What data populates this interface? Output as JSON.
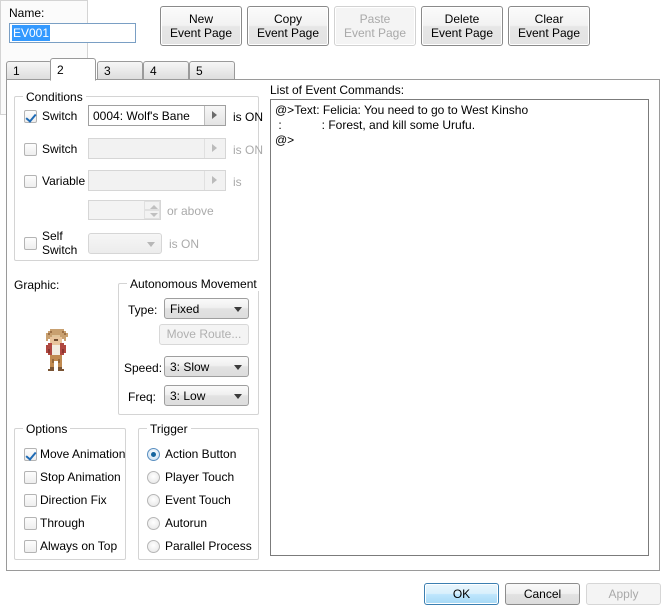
{
  "window": {
    "name_label": "Name:",
    "name_value": "EV001"
  },
  "page_buttons": [
    {
      "line1": "New",
      "line2": "Event Page",
      "enabled": true
    },
    {
      "line1": "Copy",
      "line2": "Event Page",
      "enabled": true
    },
    {
      "line1": "Paste",
      "line2": "Event Page",
      "enabled": false
    },
    {
      "line1": "Delete",
      "line2": "Event Page",
      "enabled": true
    },
    {
      "line1": "Clear",
      "line2": "Event Page",
      "enabled": true
    }
  ],
  "tabs": {
    "items": [
      "1",
      "2",
      "3",
      "4",
      "5"
    ],
    "active_index": 1
  },
  "conditions": {
    "title": "Conditions",
    "switch1": {
      "label": "Switch",
      "checked": true,
      "value": "0004: Wolf's Bane",
      "suffix": "is ON"
    },
    "switch2": {
      "label": "Switch",
      "checked": false,
      "value": "",
      "suffix": "is ON"
    },
    "variable": {
      "label": "Variable",
      "checked": false,
      "value": "",
      "suffix": "is",
      "amount": "",
      "amount_suffix": "or above"
    },
    "self_switch": {
      "label_line1": "Self",
      "label_line2": "Switch",
      "checked": false,
      "value": "",
      "suffix": "is ON"
    }
  },
  "graphic": {
    "label": "Graphic:"
  },
  "movement": {
    "title": "Autonomous Movement",
    "type_label": "Type:",
    "type_value": "Fixed",
    "move_route_label": "Move Route...",
    "move_route_enabled": false,
    "speed_label": "Speed:",
    "speed_value": "3: Slow",
    "freq_label": "Freq:",
    "freq_value": "3: Low"
  },
  "options": {
    "title": "Options",
    "items": [
      {
        "label": "Move Animation",
        "checked": true
      },
      {
        "label": "Stop Animation",
        "checked": false
      },
      {
        "label": "Direction Fix",
        "checked": false
      },
      {
        "label": "Through",
        "checked": false
      },
      {
        "label": "Always on Top",
        "checked": false
      }
    ]
  },
  "trigger": {
    "title": "Trigger",
    "items": [
      {
        "label": "Action Button",
        "selected": true
      },
      {
        "label": "Player Touch",
        "selected": false
      },
      {
        "label": "Event Touch",
        "selected": false
      },
      {
        "label": "Autorun",
        "selected": false
      },
      {
        "label": "Parallel Process",
        "selected": false
      }
    ]
  },
  "commands": {
    "label": "List of Event Commands:",
    "lines": [
      "@>Text: Felicia: You need to go to West Kinsho",
      " :            : Forest, and kill some Urufu.",
      "@>"
    ]
  },
  "dialog_buttons": {
    "ok": "OK",
    "cancel": "Cancel",
    "apply": "Apply",
    "apply_enabled": false
  },
  "colors": {
    "accent_blue": "#3399ff",
    "ok_border": "#3c7fb1",
    "check_blue": "#1f6bb5",
    "radio_dot": "#14649e"
  }
}
